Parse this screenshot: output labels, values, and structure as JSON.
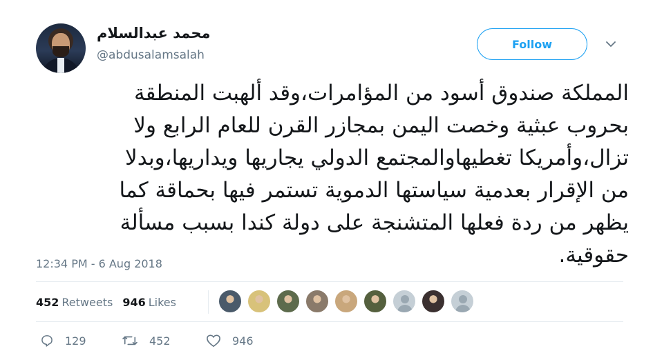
{
  "user": {
    "display_name": "محمد عبدالسلام",
    "handle": "@abdusalamsalah"
  },
  "follow_button": {
    "label": "Follow"
  },
  "tweet": {
    "lines": [
      "المملكة صندوق أسود من المؤامرات،وقد ألهبت المنطقة",
      "بحروب عبثية وخصت اليمن بمجازر القرن للعام الرابع ولا",
      "تزال،وأمريكا تغطيهاوالمجتمع الدولي يجاريها ويداريها،وبدلا",
      "من الإقرار بعدمية سياستها الدموية تستمر فيها بحماقة كما",
      "يظهر من ردة فعلها المتشنجة على دولة كندا بسبب مسألة",
      "حقوقية."
    ],
    "timestamp": "12:34 PM - 6 Aug 2018"
  },
  "stats": {
    "retweets_count": "452",
    "retweets_label": "Retweets",
    "likes_count": "946",
    "likes_label": "Likes"
  },
  "likers": [
    {
      "name": "liker-avatar-1",
      "color": "#4a5a6a"
    },
    {
      "name": "liker-avatar-2",
      "color": "#d8c27a"
    },
    {
      "name": "liker-avatar-3",
      "color": "#5d6b4c"
    },
    {
      "name": "liker-avatar-4",
      "color": "#8a7a6a"
    },
    {
      "name": "liker-avatar-5",
      "color": "#c9a77c"
    },
    {
      "name": "liker-avatar-6",
      "color": "#55603e"
    },
    {
      "name": "liker-avatar-7",
      "color": "default"
    },
    {
      "name": "liker-avatar-8",
      "color": "#3b3030"
    },
    {
      "name": "liker-avatar-9",
      "color": "default"
    }
  ],
  "actions": {
    "reply_count": "129",
    "retweet_count": "452",
    "like_count": "946"
  },
  "colors": {
    "accent": "#1da1f2",
    "secondary_text": "#657786",
    "primary_text": "#14171a"
  }
}
